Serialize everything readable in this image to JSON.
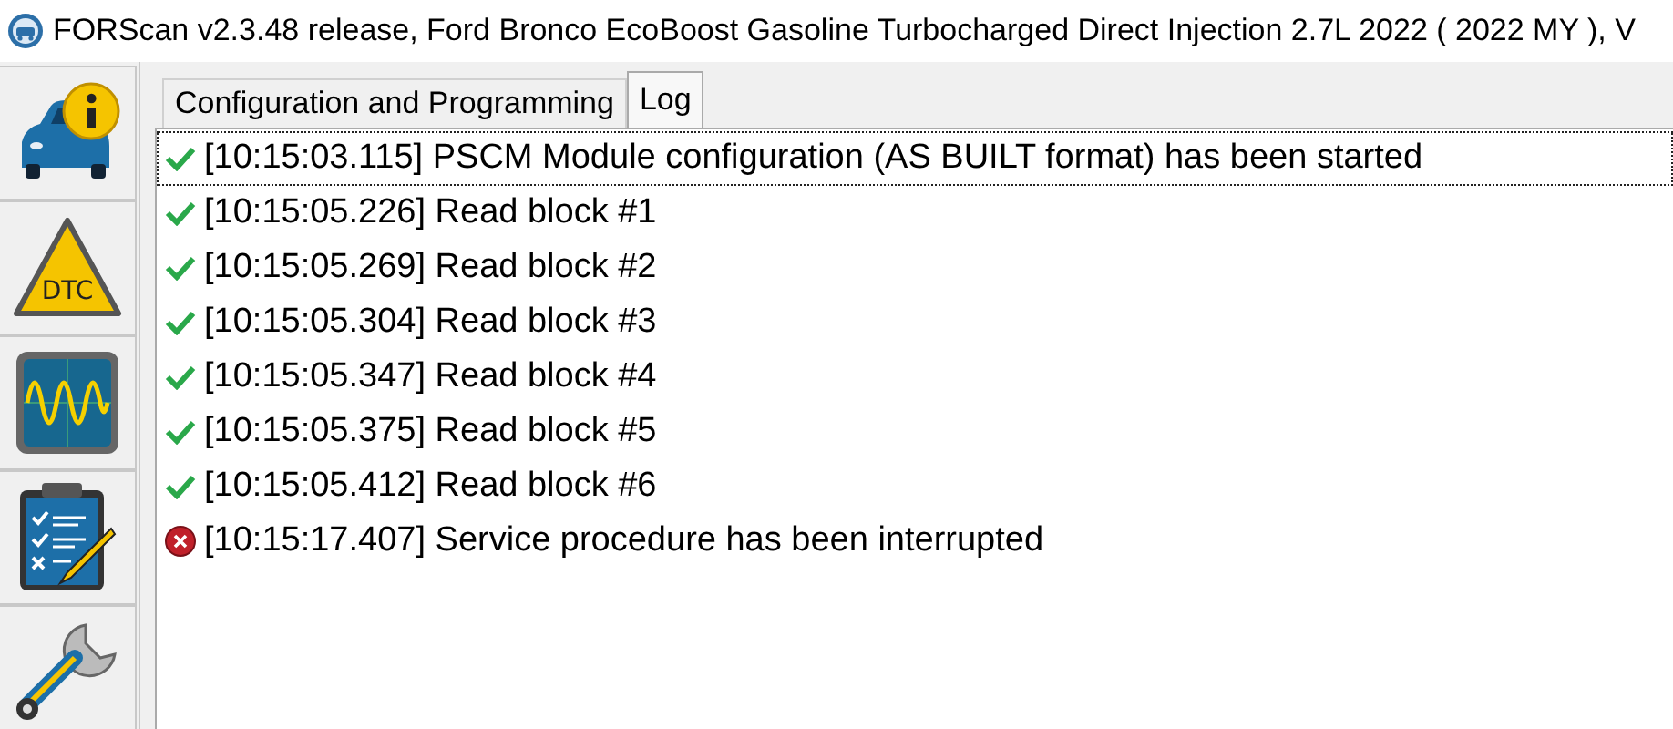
{
  "window": {
    "title": "FORScan v2.3.48 release, Ford Bronco EcoBoost Gasoline Turbocharged Direct Injection 2.7L 2022 ( 2022 MY ), V"
  },
  "sidebar": {
    "items": [
      {
        "kind": "vehicle-info"
      },
      {
        "kind": "dtc",
        "label": "DTC"
      },
      {
        "kind": "oscilloscope"
      },
      {
        "kind": "checklist"
      },
      {
        "kind": "wrench"
      }
    ]
  },
  "tabs": [
    {
      "label": "Configuration and Programming",
      "selected": false
    },
    {
      "label": "Log",
      "selected": true
    }
  ],
  "log": [
    {
      "kind": "ok",
      "selected": true,
      "text": "[10:15:03.115] PSCM Module configuration (AS BUILT format) has been started"
    },
    {
      "kind": "ok",
      "selected": false,
      "text": "[10:15:05.226] Read block #1"
    },
    {
      "kind": "ok",
      "selected": false,
      "text": "[10:15:05.269] Read block #2"
    },
    {
      "kind": "ok",
      "selected": false,
      "text": "[10:15:05.304] Read block #3"
    },
    {
      "kind": "ok",
      "selected": false,
      "text": "[10:15:05.347] Read block #4"
    },
    {
      "kind": "ok",
      "selected": false,
      "text": "[10:15:05.375] Read block #5"
    },
    {
      "kind": "ok",
      "selected": false,
      "text": "[10:15:05.412] Read block #6"
    },
    {
      "kind": "error",
      "selected": false,
      "text": "[10:15:17.407] Service procedure has been interrupted"
    }
  ]
}
